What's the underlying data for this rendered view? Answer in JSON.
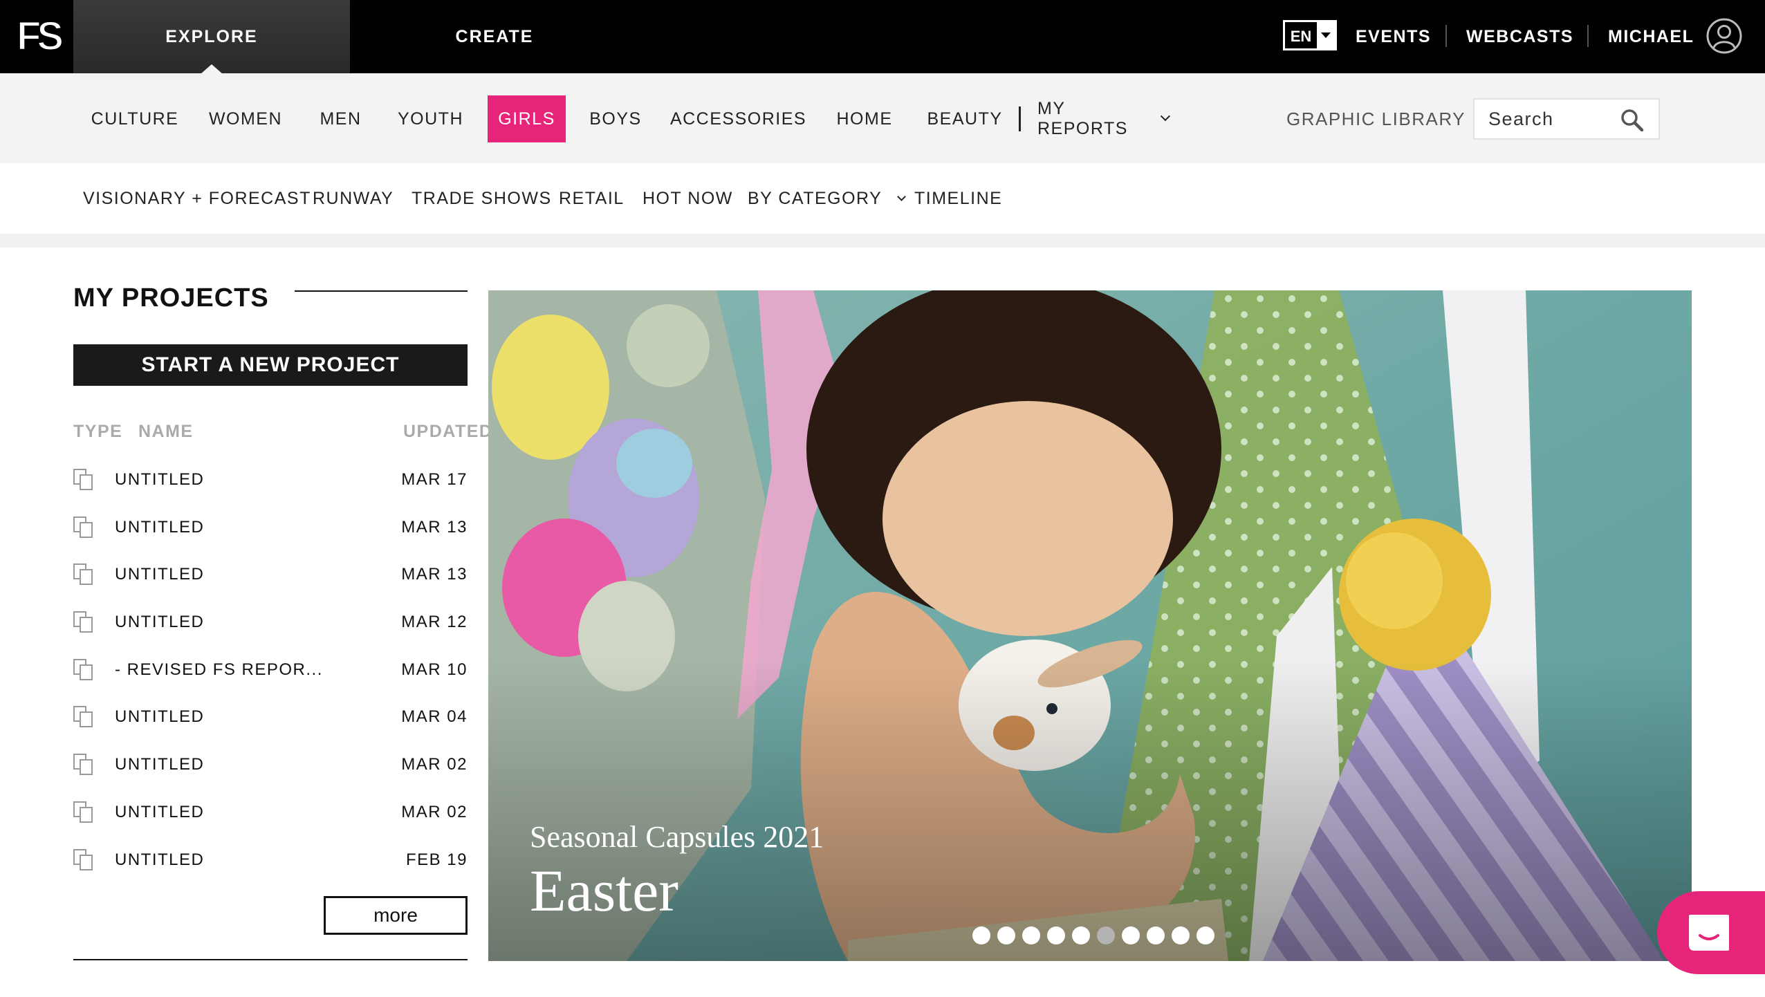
{
  "brand": {
    "logo_text": "FS"
  },
  "topnav": {
    "explore": "EXPLORE",
    "create": "CREATE",
    "language": "EN",
    "events": "EVENTS",
    "webcasts": "WEBCASTS",
    "user": "MICHAEL"
  },
  "categories": {
    "items": [
      "CULTURE",
      "WOMEN",
      "MEN",
      "YOUTH",
      "GIRLS",
      "BOYS",
      "ACCESSORIES",
      "HOME",
      "BEAUTY"
    ],
    "active": "GIRLS",
    "my_reports": "MY REPORTS",
    "graphic_library": "GRAPHIC LIBRARY",
    "search_placeholder": "Search"
  },
  "subnav": {
    "items": [
      "VISIONARY + FORECAST",
      "RUNWAY",
      "TRADE SHOWS",
      "RETAIL",
      "HOT NOW"
    ],
    "by_category": "BY CATEGORY",
    "timeline": "TIMELINE"
  },
  "projects": {
    "title": "MY PROJECTS",
    "new_button": "START A NEW PROJECT",
    "col_type": "TYPE",
    "col_name": "NAME",
    "col_updated": "UPDATED",
    "rows": [
      {
        "name": "UNTITLED",
        "date": "MAR 17"
      },
      {
        "name": "UNTITLED",
        "date": "MAR 13"
      },
      {
        "name": "UNTITLED",
        "date": "MAR 13"
      },
      {
        "name": "UNTITLED",
        "date": "MAR 12"
      },
      {
        "name": "- REVISED FS REPOR...",
        "date": "MAR 10"
      },
      {
        "name": "UNTITLED",
        "date": "MAR 04"
      },
      {
        "name": "UNTITLED",
        "date": "MAR 02"
      },
      {
        "name": "UNTITLED",
        "date": "MAR 02"
      },
      {
        "name": "UNTITLED",
        "date": "FEB 19"
      }
    ],
    "more": "more"
  },
  "hero": {
    "kicker": "Seasonal Capsules 2021",
    "headline": "Easter",
    "slide_count": 10,
    "active_slide": 6
  },
  "colors": {
    "accent": "#e6247a",
    "topbar": "#000000",
    "nav_bg": "#f3f3f3"
  },
  "icons": {
    "search": "magnifier-icon",
    "user": "user-circle-icon",
    "chat": "chat-icon",
    "project": "copy-pages-icon"
  }
}
